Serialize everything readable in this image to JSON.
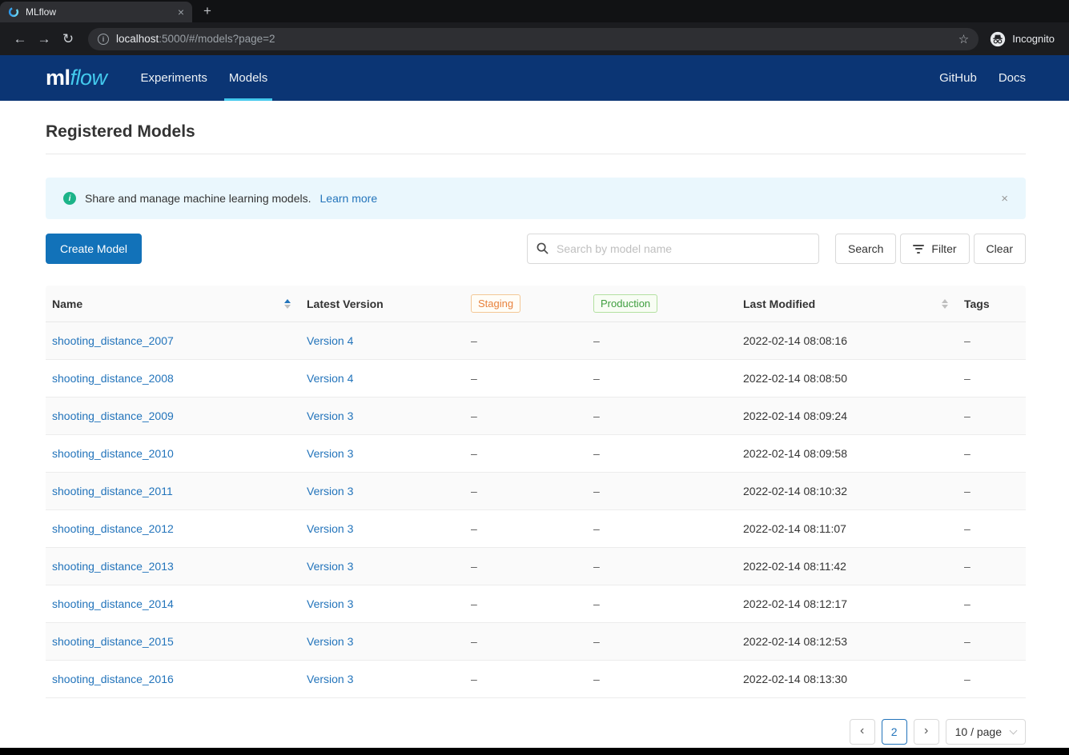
{
  "browser": {
    "tab_title": "MLflow",
    "url_host": "localhost",
    "url_rest": ":5000/#/models?page=2",
    "incognito_label": "Incognito"
  },
  "icons": {
    "close": "×",
    "plus": "+",
    "back": "←",
    "forward": "→",
    "reload": "↻",
    "info_i": "i",
    "star": "☆",
    "banner_i": "i",
    "banner_close": "×",
    "chevron_left": "‹",
    "chevron_right": "›"
  },
  "header": {
    "logo_ml": "ml",
    "logo_flow": "flow",
    "nav": [
      {
        "label": "Experiments",
        "active": false
      },
      {
        "label": "Models",
        "active": true
      }
    ],
    "right_nav": [
      "GitHub",
      "Docs"
    ]
  },
  "page": {
    "title": "Registered Models",
    "banner": {
      "text": "Share and manage machine learning models.",
      "link": "Learn more"
    },
    "create_button": "Create Model",
    "search": {
      "placeholder": "Search by model name",
      "search_label": "Search",
      "filter_label": "Filter",
      "clear_label": "Clear"
    }
  },
  "table": {
    "columns": {
      "name": "Name",
      "latest_version": "Latest Version",
      "staging": "Staging",
      "production": "Production",
      "last_modified": "Last Modified",
      "tags": "Tags"
    },
    "sorted_column": "Name",
    "sorted_direction": "asc",
    "rows": [
      {
        "name": "shooting_distance_2007",
        "version": "Version 4",
        "staging": "–",
        "production": "–",
        "modified": "2022-02-14 08:08:16",
        "tags": "–"
      },
      {
        "name": "shooting_distance_2008",
        "version": "Version 4",
        "staging": "–",
        "production": "–",
        "modified": "2022-02-14 08:08:50",
        "tags": "–"
      },
      {
        "name": "shooting_distance_2009",
        "version": "Version 3",
        "staging": "–",
        "production": "–",
        "modified": "2022-02-14 08:09:24",
        "tags": "–"
      },
      {
        "name": "shooting_distance_2010",
        "version": "Version 3",
        "staging": "–",
        "production": "–",
        "modified": "2022-02-14 08:09:58",
        "tags": "–"
      },
      {
        "name": "shooting_distance_2011",
        "version": "Version 3",
        "staging": "–",
        "production": "–",
        "modified": "2022-02-14 08:10:32",
        "tags": "–"
      },
      {
        "name": "shooting_distance_2012",
        "version": "Version 3",
        "staging": "–",
        "production": "–",
        "modified": "2022-02-14 08:11:07",
        "tags": "–"
      },
      {
        "name": "shooting_distance_2013",
        "version": "Version 3",
        "staging": "–",
        "production": "–",
        "modified": "2022-02-14 08:11:42",
        "tags": "–"
      },
      {
        "name": "shooting_distance_2014",
        "version": "Version 3",
        "staging": "–",
        "production": "–",
        "modified": "2022-02-14 08:12:17",
        "tags": "–"
      },
      {
        "name": "shooting_distance_2015",
        "version": "Version 3",
        "staging": "–",
        "production": "–",
        "modified": "2022-02-14 08:12:53",
        "tags": "–"
      },
      {
        "name": "shooting_distance_2016",
        "version": "Version 3",
        "staging": "–",
        "production": "–",
        "modified": "2022-02-14 08:13:30",
        "tags": "–"
      }
    ]
  },
  "pagination": {
    "current": "2",
    "page_size": "10 / page"
  },
  "colors": {
    "brand_navy": "#0b3574",
    "brand_cyan": "#43c9ed",
    "link_blue": "#2374bb",
    "primary_button_blue": "#1272b9",
    "staging_orange": "#e8823d",
    "production_green": "#3f9e3f",
    "banner_bg": "#eaf7fd",
    "banner_icon_green": "#1cb489"
  }
}
